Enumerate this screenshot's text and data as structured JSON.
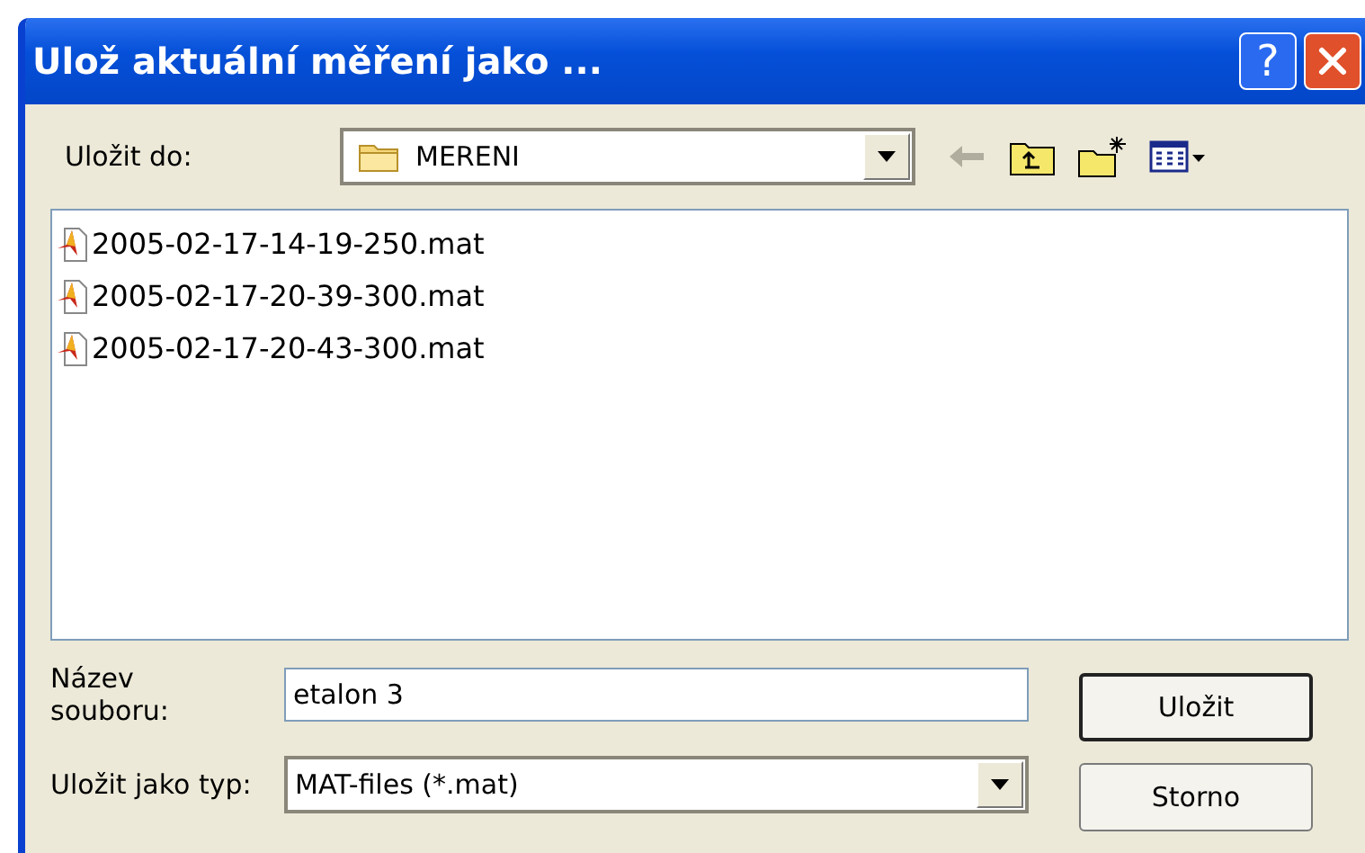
{
  "window": {
    "title": "Ulož aktuální měření jako ...",
    "help_label": "?"
  },
  "save_in": {
    "label": "Uložit do:",
    "value": "MERENI"
  },
  "toolbar": [
    {
      "kind": "back",
      "disabled": true
    },
    {
      "kind": "up",
      "disabled": false
    },
    {
      "kind": "new-folder",
      "disabled": false
    },
    {
      "kind": "view-menu",
      "disabled": false
    }
  ],
  "files": [
    {
      "name": "2005-02-17-14-19-250.mat",
      "selected": false
    },
    {
      "name": "2005-02-17-20-39-300.mat",
      "selected": false
    },
    {
      "name": "2005-02-17-20-43-300.mat",
      "selected": false
    }
  ],
  "file_name": {
    "label": "Název souboru:",
    "value": "etalon 3"
  },
  "file_type": {
    "label": "Uložit jako typ:",
    "value": "MAT-files (*.mat)"
  },
  "buttons": [
    {
      "label": "Uložit",
      "default": true
    },
    {
      "label": "Storno",
      "default": false
    }
  ]
}
